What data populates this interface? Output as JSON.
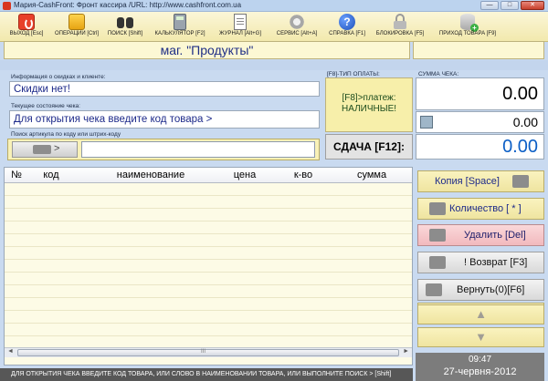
{
  "window": {
    "title": "Мария-CashFront: Фронт кассира /URL: http://www.cashfront.com.ua",
    "minimize_glyph": "—",
    "maximize_glyph": "□",
    "close_glyph": "✕"
  },
  "toolbar": {
    "exit": "ВЫХОД [Esc]",
    "operations": "ОПЕРАЦИИ [Ctrl]",
    "search": "ПОИСК [Shift]",
    "calculator": "КАЛЬКУЛЯТОР [F2]",
    "journal": "ЖУРНАЛ [Alt+G]",
    "service": "СЕРВИС [Alt+A]",
    "help": "СПРАВКА [F1]",
    "lock": "БЛОКИРОВКА [F5]",
    "goods_receipt": "ПРИХОД ТОВАРА [F9]",
    "help_glyph": "?"
  },
  "store": {
    "name": "маг. \"Продукты\""
  },
  "discount": {
    "caption": "Информация о скидках и клиенте:",
    "value": "Скидки нет!"
  },
  "check_state": {
    "caption": "Текущее состояние чека:",
    "value": "Для открытия чека введите код товара >"
  },
  "article_search": {
    "caption": "Поиск артикула по коду или штрих-коду",
    "arrow": ">",
    "value": ""
  },
  "payment": {
    "caption_type": "[F8]-ТИП ОПЛАТЫ:",
    "caption_sum": "СУММА ЧЕКА:",
    "type_line1": "[F8]>платеж:",
    "type_line2": "НАЛИЧНЫЕ!",
    "total": "0.00",
    "subtotal": "0.00",
    "change_label": "СДАЧА [F12]:",
    "change": "0.00"
  },
  "table": {
    "columns": [
      "№",
      "код",
      "наименование",
      "цена",
      "к-во",
      "сумма"
    ],
    "rows": [],
    "scroll_left": "◄",
    "scroll_right": "►",
    "scroll_grip": "III"
  },
  "actions": {
    "copy": "Копия [Space]",
    "quantity": "Количество [ * ]",
    "delete": "Удалить [Del]",
    "return": "! Возврат [F3]",
    "return_zero": "Вернуть(0)[F6]",
    "up": "▲",
    "down": "▼"
  },
  "clock": {
    "time": "09:47",
    "date": "27-червня-2012"
  },
  "status": {
    "text": "ДЛЯ ОТКРЫТИЯ ЧЕКА ВВЕДИТЕ КОД ТОВАРА, ИЛИ СЛОВО В НАИМЕНОВАНИИ ТОВАРА, ИЛИ ВЫПОЛНИТЕ ПОИСК > [Shift]"
  }
}
